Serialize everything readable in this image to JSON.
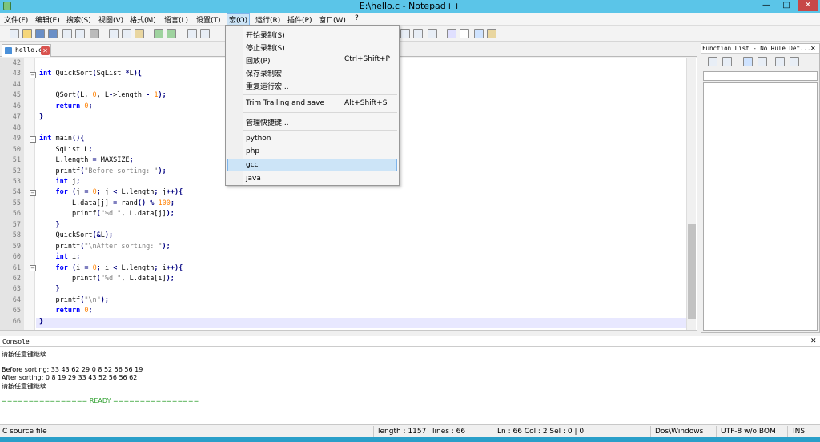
{
  "window": {
    "title": "E:\\hello.c - Notepad++",
    "min_glyph": "—",
    "max_glyph": "□",
    "close_glyph": "✕"
  },
  "menubar": [
    {
      "label": "文件(F)"
    },
    {
      "label": "编辑(E)"
    },
    {
      "label": "搜索(S)"
    },
    {
      "label": "视图(V)"
    },
    {
      "label": "格式(M)"
    },
    {
      "label": "语言(L)"
    },
    {
      "label": "设置(T)"
    },
    {
      "label": "宏(O)"
    },
    {
      "label": "运行(R)"
    },
    {
      "label": "插件(P)"
    },
    {
      "label": "窗口(W)"
    },
    {
      "label": "?"
    }
  ],
  "tab": {
    "label": "hello.c",
    "close_glyph": "✕"
  },
  "code": {
    "lines": [
      {
        "n": "42",
        "t": ""
      },
      {
        "n": "43",
        "t": "int QuickSort(SqList *L){"
      },
      {
        "n": "44",
        "t": ""
      },
      {
        "n": "45",
        "t": "    QSort(L, 0, L->length - 1);"
      },
      {
        "n": "46",
        "t": "    return 0;"
      },
      {
        "n": "47",
        "t": "}"
      },
      {
        "n": "48",
        "t": ""
      },
      {
        "n": "49",
        "t": "int main(){"
      },
      {
        "n": "50",
        "t": "    SqList L;"
      },
      {
        "n": "51",
        "t": "    L.length = MAXSIZE;"
      },
      {
        "n": "52",
        "t": "    printf(\"Before sorting: \");"
      },
      {
        "n": "53",
        "t": "    int j;"
      },
      {
        "n": "54",
        "t": "    for (j = 0; j < L.length; j++){"
      },
      {
        "n": "55",
        "t": "        L.data[j] = rand() % 100;"
      },
      {
        "n": "56",
        "t": "        printf(\"%d \", L.data[j]);"
      },
      {
        "n": "57",
        "t": "    }"
      },
      {
        "n": "58",
        "t": "    QuickSort(&L);"
      },
      {
        "n": "59",
        "t": "    printf(\"\\nAfter sorting: \");"
      },
      {
        "n": "60",
        "t": "    int i;"
      },
      {
        "n": "61",
        "t": "    for (i = 0; i < L.length; i++){"
      },
      {
        "n": "62",
        "t": "        printf(\"%d \", L.data[i]);"
      },
      {
        "n": "63",
        "t": "    }"
      },
      {
        "n": "64",
        "t": "    printf(\"\\n\");"
      },
      {
        "n": "65",
        "t": "    return 0;"
      },
      {
        "n": "66",
        "t": "}"
      }
    ]
  },
  "function_list": {
    "title": "Function List - No Rule Def...",
    "close_glyph": "✕"
  },
  "console": {
    "title": "Console",
    "close_glyph": "✕",
    "lines": [
      "请按任意键继续. . .",
      "",
      "Before sorting: 33 43 62 29 0 8 52 56 56 19",
      "After sorting: 0 8 19 29 33 43 52 56 56 62",
      "请按任意键继续. . .",
      "",
      "================ READY ================"
    ]
  },
  "macro_menu": {
    "items": [
      {
        "label": "开始录制(S)",
        "shortcut": ""
      },
      {
        "label": "停止录制(S)",
        "shortcut": ""
      },
      {
        "label": "回放(P)",
        "shortcut": "Ctrl+Shift+P"
      },
      {
        "label": "保存录制宏",
        "shortcut": ""
      },
      {
        "label": "重复运行宏...",
        "shortcut": ""
      },
      {
        "label": "Trim Trailing and save",
        "shortcut": "Alt+Shift+S"
      },
      {
        "label": "管理快捷键...",
        "shortcut": ""
      },
      {
        "label": "python",
        "shortcut": ""
      },
      {
        "label": "php",
        "shortcut": ""
      },
      {
        "label": "gcc",
        "shortcut": ""
      },
      {
        "label": "java",
        "shortcut": ""
      }
    ]
  },
  "statusbar": {
    "file_type": "C source file",
    "length": "length : 1157",
    "lines": "lines : 66",
    "position": "Ln : 66    Col : 2    Sel : 0 | 0",
    "eol": "Dos\\Windows",
    "encoding": "UTF-8 w/o BOM",
    "mode": "INS"
  },
  "colors": {
    "titlebar": "#5bc5e8",
    "keyword": "#0000ff",
    "number": "#ff8000",
    "string": "#808080",
    "ready": "#2fa02f"
  }
}
